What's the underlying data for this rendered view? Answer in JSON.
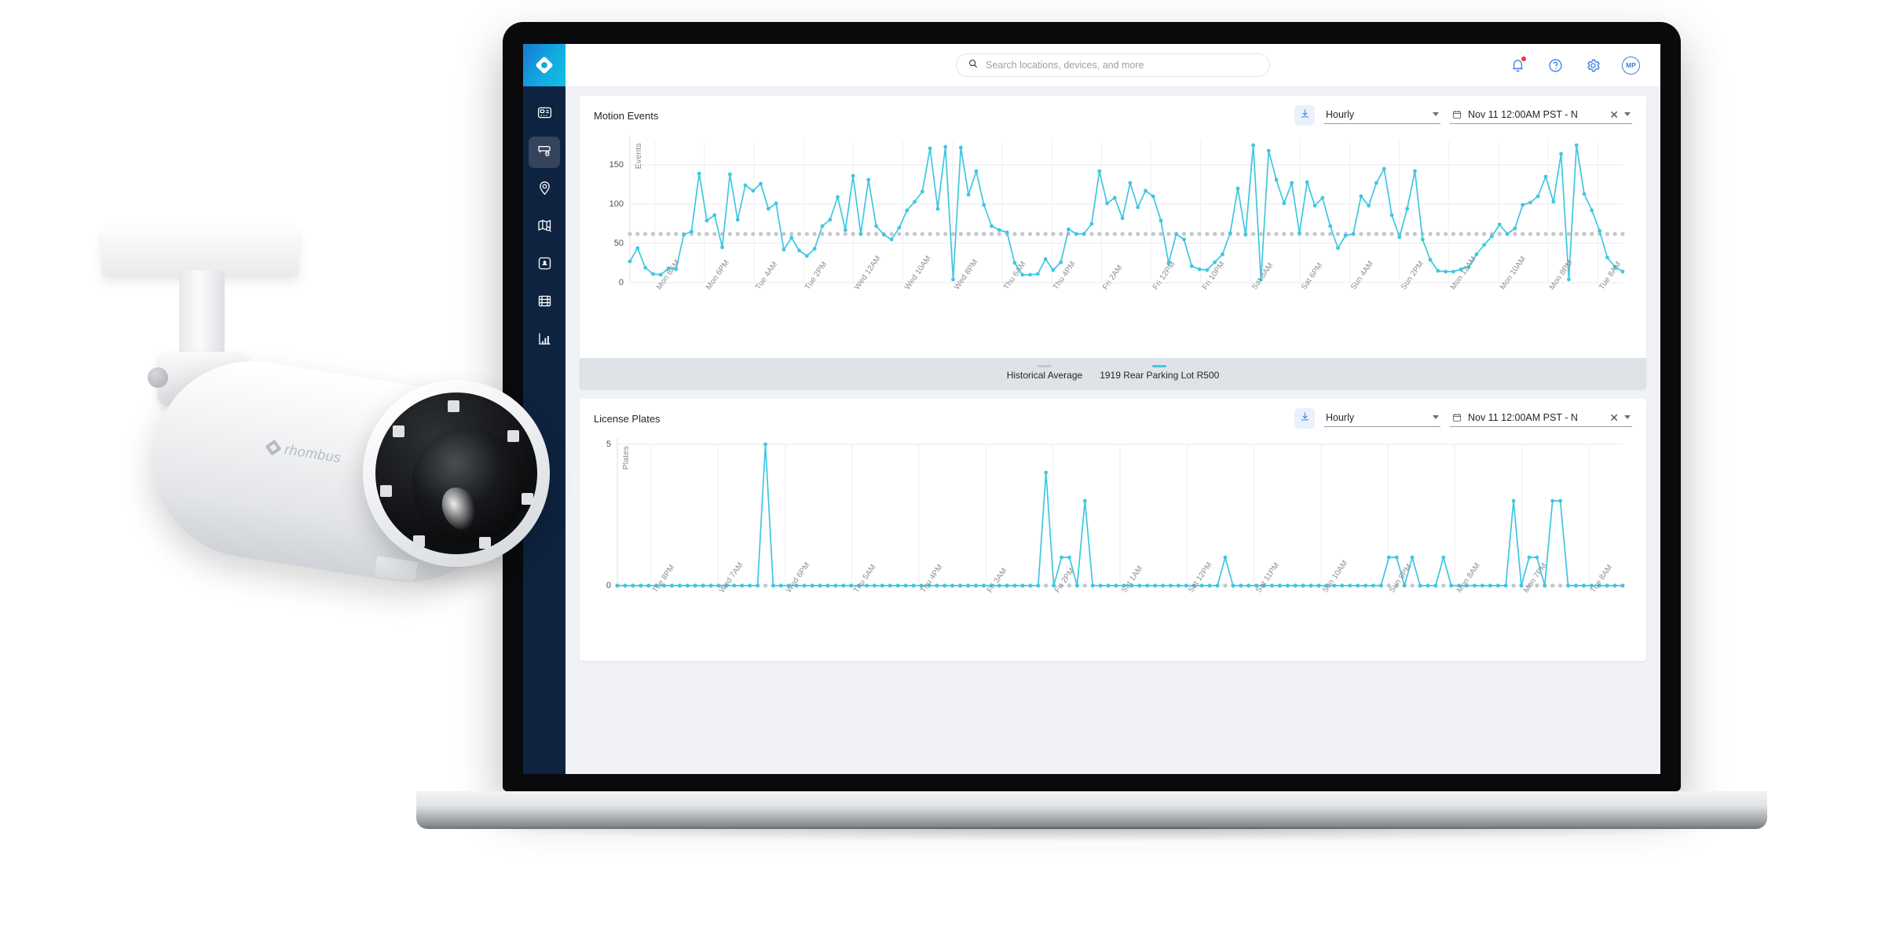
{
  "app": {
    "logo_name": "rhombus-logo",
    "sidebar": {
      "items": [
        {
          "id": "dashboard",
          "icon": "dashboard-icon",
          "label": "Dashboard",
          "active": false
        },
        {
          "id": "cameras",
          "icon": "camera-icon",
          "label": "Cameras",
          "active": true
        },
        {
          "id": "locations",
          "icon": "location-pin-icon",
          "label": "Locations",
          "active": false
        },
        {
          "id": "maps",
          "icon": "map-search-icon",
          "label": "Maps",
          "active": false
        },
        {
          "id": "sensors",
          "icon": "sensor-icon",
          "label": "Sensors",
          "active": false
        },
        {
          "id": "clips",
          "icon": "film-icon",
          "label": "Clips",
          "active": false
        },
        {
          "id": "reports",
          "icon": "bar-chart-icon",
          "label": "Reports",
          "active": false
        }
      ]
    },
    "topbar": {
      "search_placeholder": "Search locations, devices, and more",
      "search_value": "",
      "notifications_badge": true,
      "avatar_initials": "MP"
    }
  },
  "panels": [
    {
      "title": "Motion Events",
      "download_label": "Download",
      "interval": "Hourly",
      "date_range": "Nov 11 12:00AM PST - N",
      "clear_label": "✕",
      "legend": [
        {
          "label": "Historical Average",
          "color": "#c4c7cb"
        },
        {
          "label": "1919 Rear Parking Lot R500",
          "color": "#3fc7e0"
        }
      ]
    },
    {
      "title": "License Plates",
      "download_label": "Download",
      "interval": "Hourly",
      "date_range": "Nov 11 12:00AM PST - N",
      "clear_label": "✕",
      "legend": []
    }
  ],
  "device": {
    "brand": "rhombus"
  },
  "chart_data": [
    {
      "type": "line",
      "title": "Motion Events",
      "xlabel": "",
      "ylabel": "Events",
      "ylim": [
        0,
        180
      ],
      "yticks": [
        0,
        50,
        100,
        150
      ],
      "grid": true,
      "legend_position": "bottom",
      "xticks": [
        "Mon 8AM",
        "Mon 6PM",
        "Tue 4AM",
        "Tue 2PM",
        "Wed 12AM",
        "Wed 10AM",
        "Wed 8PM",
        "Thu 6AM",
        "Thu 4PM",
        "Fri 2AM",
        "Fri 12PM",
        "Fri 10PM",
        "Sat 8AM",
        "Sat 6PM",
        "Sun 4AM",
        "Sun 2PM",
        "Mon 12AM",
        "Mon 10AM",
        "Mon 8PM",
        "Tue 8AM"
      ],
      "series": [
        {
          "name": "1919 Rear Parking Lot R500",
          "color": "#3fc7e0",
          "values": [
            27,
            44,
            19,
            11,
            10,
            18,
            17,
            61,
            65,
            139,
            79,
            86,
            45,
            138,
            80,
            124,
            117,
            126,
            94,
            101,
            42,
            57,
            41,
            34,
            43,
            72,
            80,
            109,
            67,
            136,
            62,
            131,
            72,
            61,
            55,
            70,
            92,
            103,
            116,
            171,
            94,
            173,
            4,
            172,
            112,
            142,
            99,
            72,
            67,
            64,
            25,
            10,
            10,
            11,
            30,
            16,
            26,
            68,
            62,
            62,
            75,
            142,
            101,
            108,
            82,
            127,
            96,
            117,
            110,
            79,
            25,
            62,
            55,
            21,
            17,
            16,
            26,
            36,
            63,
            120,
            61,
            175,
            4,
            168,
            131,
            101,
            127,
            63,
            128,
            98,
            108,
            72,
            44,
            60,
            62,
            110,
            98,
            127,
            145,
            86,
            58,
            94,
            142,
            55,
            29,
            15,
            14,
            14,
            17,
            20,
            36,
            48,
            59,
            74,
            62,
            69,
            99,
            102,
            110,
            135,
            103,
            164,
            4,
            175,
            113,
            92,
            66,
            32,
            20,
            14
          ]
        },
        {
          "name": "Historical Average",
          "color": "#c4c7cb",
          "style": "dotted",
          "values": [
            62,
            62,
            62,
            62,
            62,
            62,
            62,
            62,
            62,
            62,
            62,
            62,
            62,
            62,
            62,
            62,
            62,
            62,
            62,
            62,
            62,
            62,
            62,
            62,
            62,
            62,
            62,
            62,
            62,
            62,
            62,
            62,
            62,
            62,
            62,
            62,
            62,
            62,
            62,
            62,
            62,
            62,
            62,
            62,
            62,
            62,
            62,
            62,
            62,
            62,
            62,
            62,
            62,
            62,
            62,
            62,
            62,
            62,
            62,
            62,
            62,
            62,
            62,
            62,
            62,
            62,
            62,
            62,
            62,
            62,
            62,
            62,
            62,
            62,
            62,
            62,
            62,
            62,
            62,
            62,
            62,
            62,
            62,
            62,
            62,
            62,
            62,
            62,
            62,
            62,
            62,
            62,
            62,
            62,
            62,
            62,
            62,
            62,
            62,
            62,
            62,
            62,
            62,
            62,
            62,
            62,
            62,
            62,
            62,
            62,
            62,
            62,
            62,
            62,
            62,
            62,
            62,
            62,
            62,
            62,
            62,
            62,
            62,
            62,
            62,
            62,
            62,
            62,
            62,
            62
          ]
        }
      ]
    },
    {
      "type": "line",
      "title": "License Plates",
      "xlabel": "",
      "ylabel": "Plates",
      "ylim": [
        0,
        5
      ],
      "yticks": [
        0,
        5
      ],
      "grid": true,
      "legend_position": "bottom",
      "xticks": [
        "Tue 8PM",
        "Wed 7AM",
        "Wed 6PM",
        "Thu 5AM",
        "Thu 4PM",
        "Fri 3AM",
        "Fri 2PM",
        "Sat 1AM",
        "Sat 12PM",
        "Sat 11PM",
        "Sun 10AM",
        "Sun 9PM",
        "Mon 8AM",
        "Mon 7PM",
        "Tue 8AM"
      ],
      "series": [
        {
          "name": "License Plates",
          "color": "#3fc7e0",
          "values": [
            0,
            0,
            0,
            0,
            0,
            0,
            0,
            0,
            0,
            0,
            0,
            0,
            0,
            0,
            0,
            0,
            0,
            0,
            0,
            5,
            0,
            0,
            0,
            0,
            0,
            0,
            0,
            0,
            0,
            0,
            0,
            0,
            0,
            0,
            0,
            0,
            0,
            0,
            0,
            0,
            0,
            0,
            0,
            0,
            0,
            0,
            0,
            0,
            0,
            0,
            0,
            0,
            0,
            0,
            0,
            4,
            0,
            1,
            1,
            0,
            3,
            0,
            0,
            0,
            0,
            0,
            0,
            0,
            0,
            0,
            0,
            0,
            0,
            0,
            0,
            0,
            0,
            0,
            1,
            0,
            0,
            0,
            0,
            0,
            0,
            0,
            0,
            0,
            0,
            0,
            0,
            0,
            0,
            0,
            0,
            0,
            0,
            0,
            0,
            1,
            1,
            0,
            1,
            0,
            0,
            0,
            1,
            0,
            0,
            0,
            0,
            0,
            0,
            0,
            0,
            3,
            0,
            1,
            1,
            0,
            3,
            3,
            0,
            0,
            0,
            0,
            0,
            0,
            0,
            0
          ]
        },
        {
          "name": "Historical Average",
          "color": "#c4c7cb",
          "style": "dotted",
          "values": [
            0,
            0,
            0,
            0,
            0,
            0,
            0,
            0,
            0,
            0,
            0,
            0,
            0,
            0,
            0,
            0,
            0,
            0,
            0,
            0,
            0,
            0,
            0,
            0,
            0,
            0,
            0,
            0,
            0,
            0,
            0,
            0,
            0,
            0,
            0,
            0,
            0,
            0,
            0,
            0,
            0,
            0,
            0,
            0,
            0,
            0,
            0,
            0,
            0,
            0,
            0,
            0,
            0,
            0,
            0,
            0,
            0,
            0,
            0,
            0,
            0,
            0,
            0,
            0,
            0,
            0,
            0,
            0,
            0,
            0,
            0,
            0,
            0,
            0,
            0,
            0,
            0,
            0,
            0,
            0,
            0,
            0,
            0,
            0,
            0,
            0,
            0,
            0,
            0,
            0,
            0,
            0,
            0,
            0,
            0,
            0,
            0,
            0,
            0,
            0,
            0,
            0,
            0,
            0,
            0,
            0,
            0,
            0,
            0,
            0,
            0,
            0,
            0,
            0,
            0,
            0,
            0,
            0,
            0,
            0,
            0,
            0,
            0,
            0,
            0,
            0,
            0,
            0,
            0,
            0
          ]
        }
      ]
    }
  ]
}
